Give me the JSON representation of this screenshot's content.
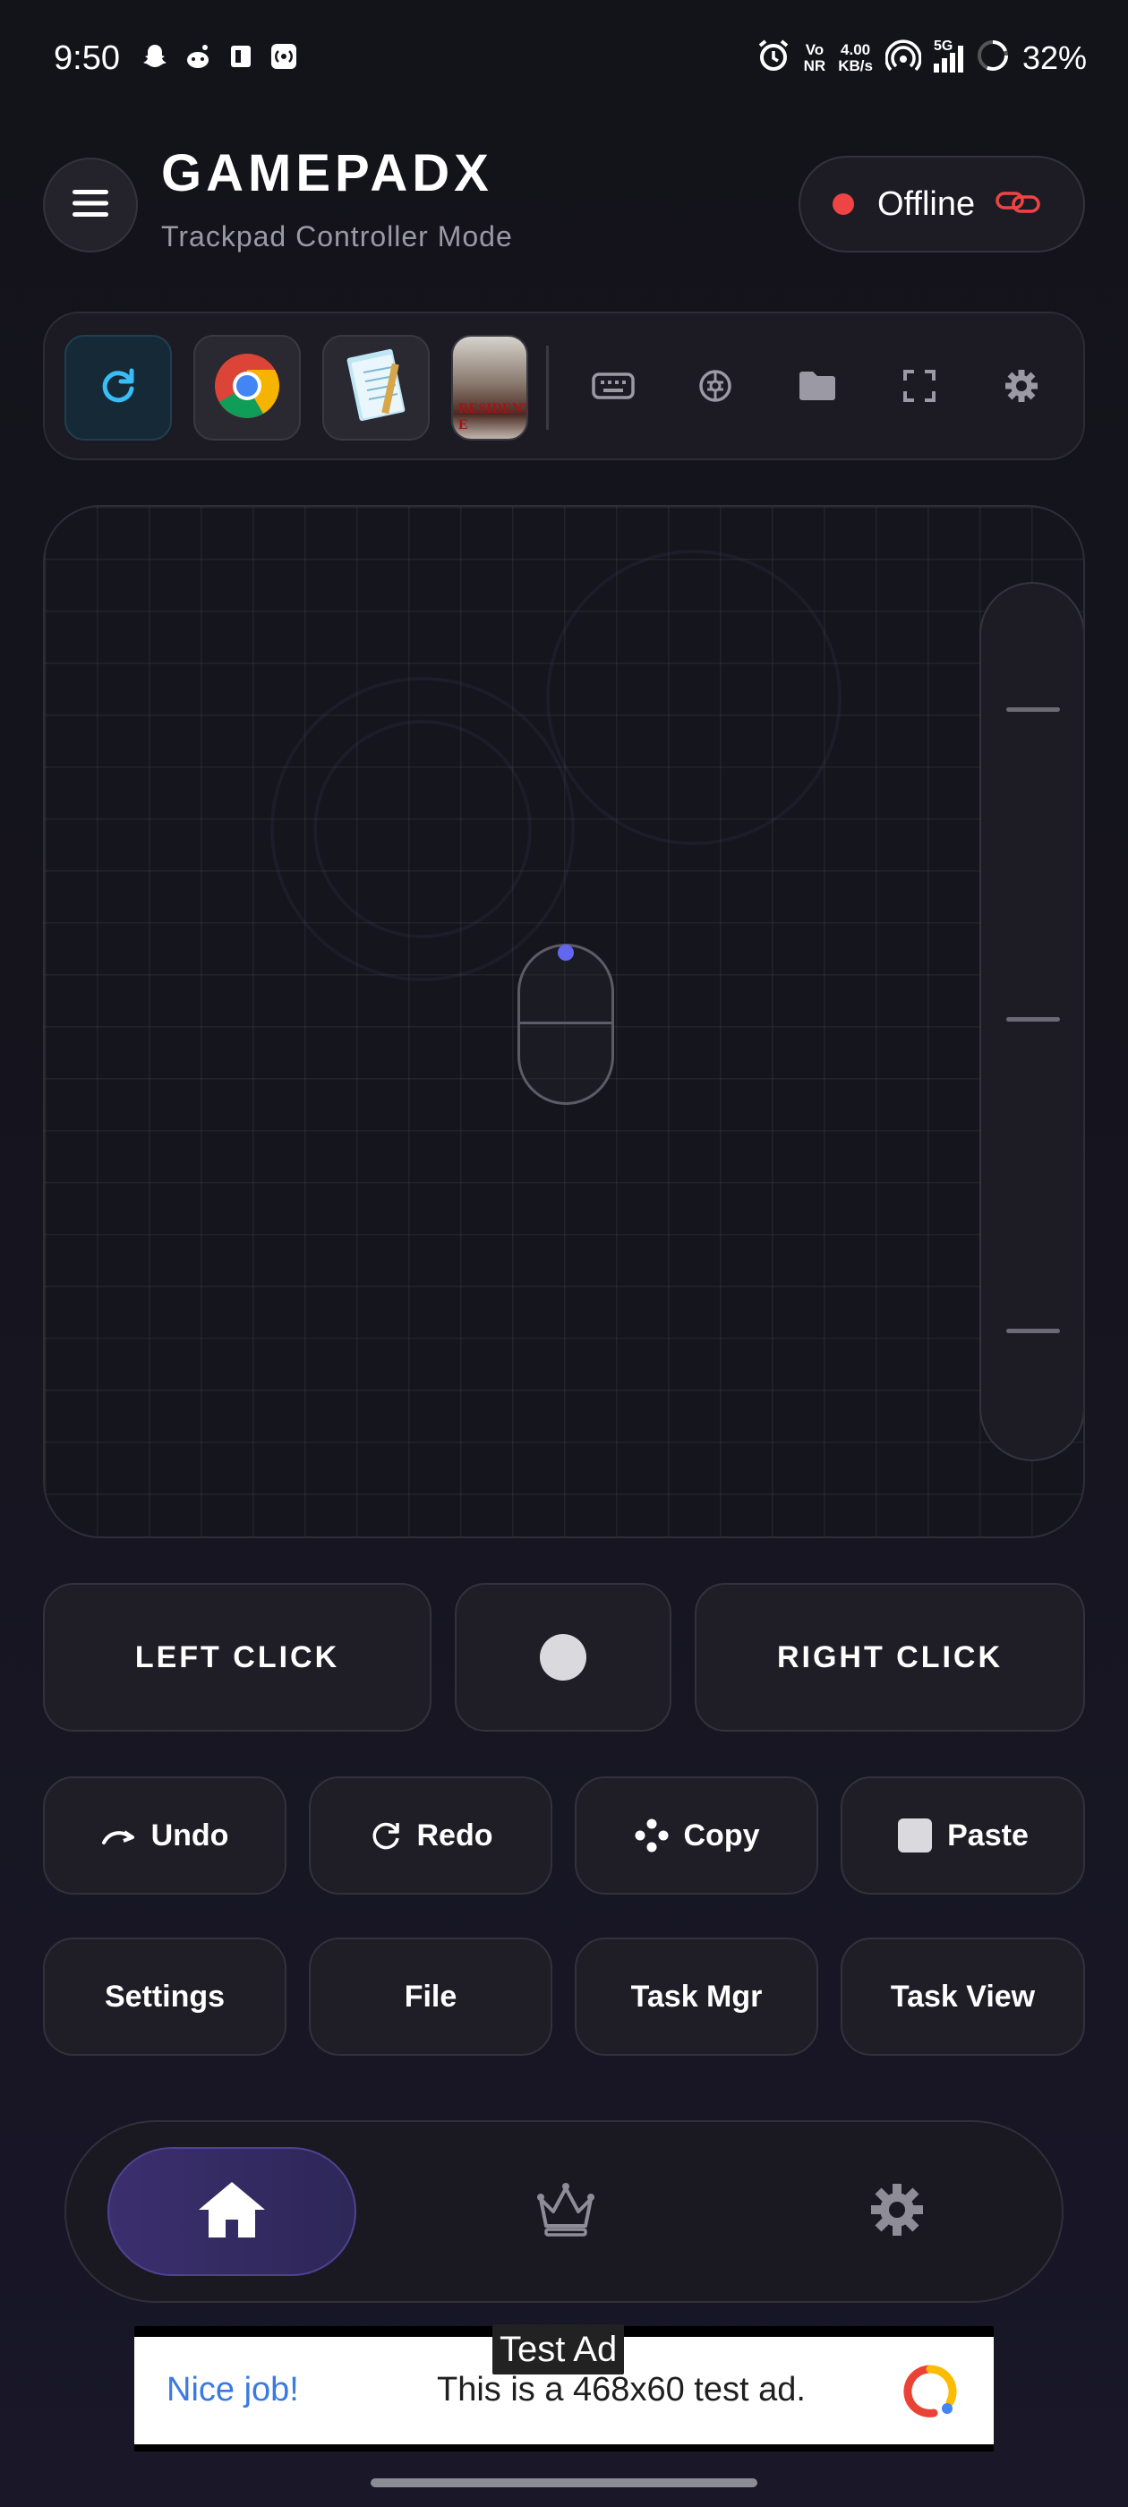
{
  "status_bar": {
    "time": "9:50",
    "notification_icons": [
      "snapchat-icon",
      "reddit-icon",
      "device-icon",
      "hotspot-icon"
    ],
    "network_label_top": "Vo",
    "network_label_bottom": "NR",
    "speed_value": "4.00",
    "speed_unit": "KB/s",
    "network_type": "5G",
    "battery": "32%"
  },
  "header": {
    "title": "GAMEPADX",
    "subtitle": "Trackpad Controller Mode",
    "connection_status": "Offline",
    "status_color": "#ef4444"
  },
  "quick_bar": {
    "apps": [
      {
        "name": "refresh",
        "icon": "refresh-icon"
      },
      {
        "name": "chrome",
        "icon": "chrome-icon"
      },
      {
        "name": "notepad",
        "icon": "notepad-icon"
      },
      {
        "name": "resident-evil",
        "icon": "game-cover-icon",
        "cover_text": "RESIDENT E"
      }
    ],
    "tools": [
      "keyboard-icon",
      "gamepad-icon",
      "folder-icon",
      "fullscreen-icon",
      "settings-icon"
    ]
  },
  "mouse_buttons": {
    "left": "LEFT CLICK",
    "right": "RIGHT CLICK"
  },
  "shortcuts": {
    "undo": "Undo",
    "redo": "Redo",
    "copy": "Copy",
    "paste": "Paste",
    "settings": "Settings",
    "file": "File",
    "task_mgr": "Task Mgr",
    "task_view": "Task View"
  },
  "bottom_nav": {
    "items": [
      "home-icon",
      "crown-icon",
      "settings-icon"
    ],
    "active": "home",
    "accent": "#3b2f6e"
  },
  "ad": {
    "label": "Test Ad",
    "left_text": "Nice job!",
    "main_text": "This is a 468x60 test ad."
  }
}
